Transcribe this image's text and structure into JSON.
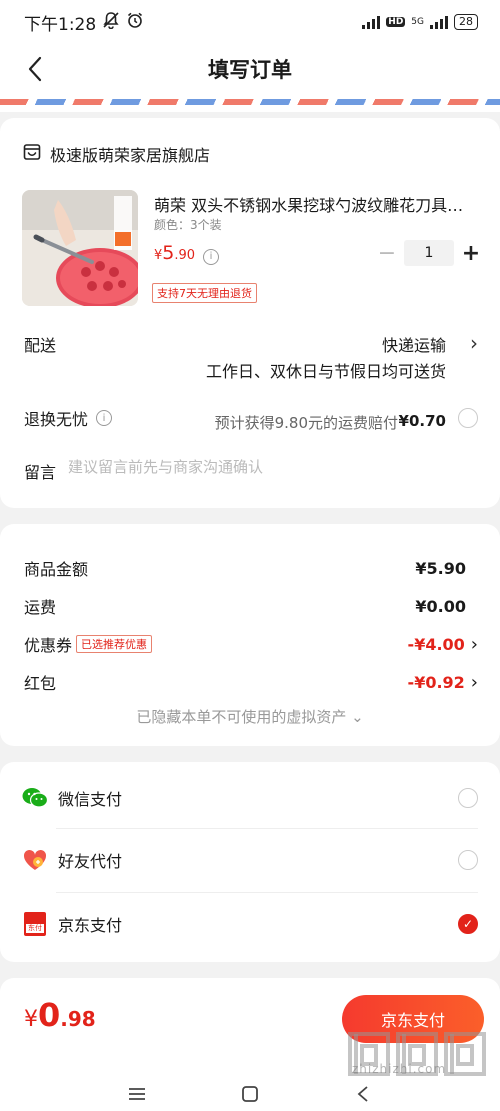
{
  "status_bar": {
    "time": "下午1:28",
    "network": "5G",
    "hd": "HD",
    "battery": "28"
  },
  "header": {
    "title": "填写订单"
  },
  "shop": {
    "name": "极速版萌荣家居旗舰店"
  },
  "product": {
    "image_caption": "双头水果挖球刀",
    "title": "萌荣  双头不锈钢水果挖球勺波纹雕花刀具果盘工具",
    "variant": "颜色：3个装",
    "price_currency": "¥",
    "price_main": "5",
    "price_decimal": ".90",
    "info": "i",
    "quantity": "1",
    "minus": "−",
    "plus": "+",
    "return_tag": "支持7天无理由退货"
  },
  "delivery": {
    "label": "配送",
    "method": "快递运输",
    "note": "工作日、双休日与节假日均可送货"
  },
  "insurance": {
    "label": "退换无忧",
    "info": "i",
    "text": "预计获得9.80元的运费赔付",
    "price": "¥0.70"
  },
  "message": {
    "label": "留言",
    "placeholder": "建议留言前先与商家沟通确认",
    "value": ""
  },
  "summary": {
    "goods_label": "商品金额",
    "goods_value": "¥5.90",
    "shipping_label": "运费",
    "shipping_value": "¥0.00",
    "coupon_label": "优惠券",
    "coupon_tag": "已选推荐优惠",
    "coupon_value": "-¥4.00",
    "redpacket_label": "红包",
    "redpacket_value": "-¥0.92",
    "hidden_assets": "已隐藏本单不可使用的虚拟资产 ⌄"
  },
  "payment": {
    "methods": [
      {
        "label": "微信支付",
        "selected": false
      },
      {
        "label": "好友代付",
        "selected": false
      },
      {
        "label": "京东支付",
        "selected": true
      }
    ],
    "jd_icon_text": "东付"
  },
  "footer": {
    "total_currency": "¥",
    "total_main": "0",
    "total_decimal": ".98",
    "pay_button": "京东支付",
    "watermark": "zhizhizhi.com"
  },
  "colors": {
    "accent": "#e2231a",
    "wechat_green": "#1aad19"
  }
}
